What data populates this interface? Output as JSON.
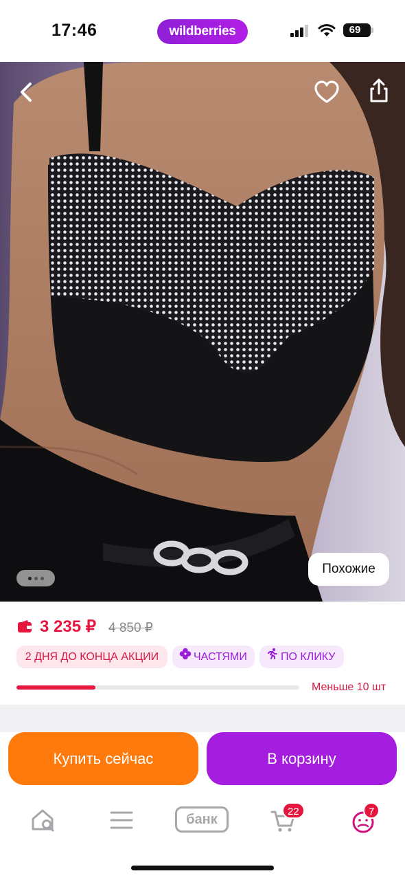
{
  "status_bar": {
    "time": "17:46",
    "app_label": "wildberries",
    "battery_level": "69"
  },
  "photo": {
    "similar_label": "Похожие",
    "carousel_pages": 3,
    "carousel_active": 0
  },
  "price": {
    "current": "3 235 ₽",
    "old": "4 850 ₽"
  },
  "chips": {
    "sale": "2 ДНЯ ДО КОНЦА АКЦИИ",
    "parts": "ЧАСТЯМИ",
    "click": "ПО КЛИКУ"
  },
  "stock": {
    "text": "Меньше 10 шт",
    "level_fraction": 0.28
  },
  "actions": {
    "buy_now": "Купить сейчас",
    "add_to_cart": "В корзину"
  },
  "tabbar": {
    "bank_label": "банк",
    "cart_badge": "22",
    "profile_badge": "7"
  },
  "colors": {
    "brand_purple": "#a51ddf",
    "buy_orange": "#ff7a0c",
    "price_red": "#e5173f"
  },
  "icons": [
    "back-arrow-icon",
    "heart-icon",
    "share-icon",
    "wallet-icon",
    "clover-icon",
    "running-person-icon",
    "home-search-icon",
    "menu-icon",
    "cart-icon",
    "profile-icon"
  ]
}
